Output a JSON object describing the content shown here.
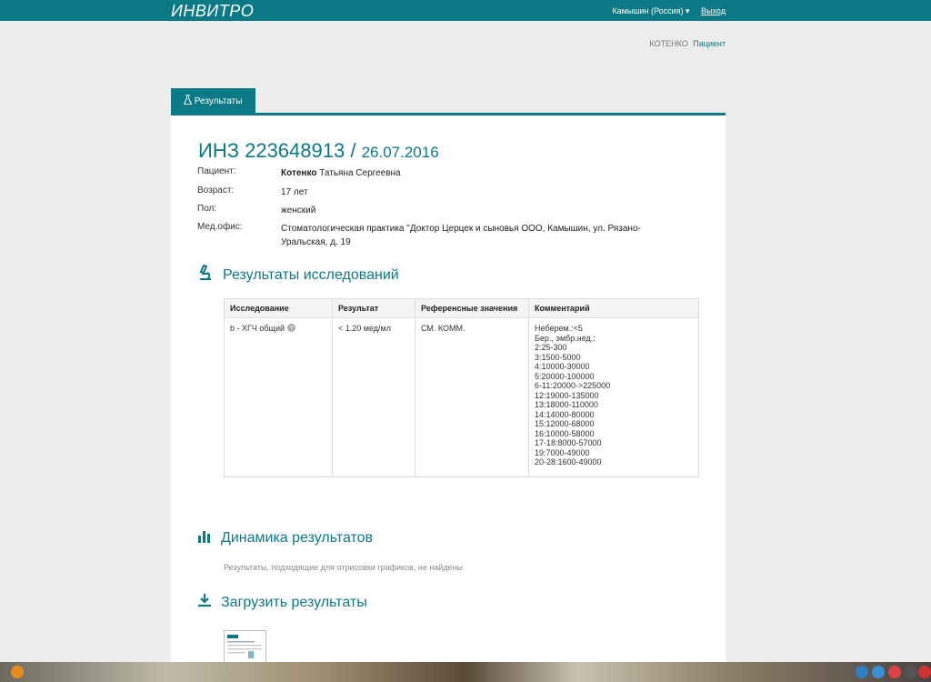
{
  "header": {
    "logo": "ИНВИТРО",
    "city": "Камышин (Россия) ▾",
    "logout": "Выход"
  },
  "user": {
    "name": "КОТЕНКО",
    "role": "Пациент"
  },
  "tab": {
    "label": "Результаты"
  },
  "order": {
    "number": "ИНЗ 223648913",
    "separator": " / ",
    "date": "26.07.2016"
  },
  "patient": {
    "patient_label": "Пациент:",
    "surname": "Котенко",
    "name": " Татьяна Сергеевна",
    "age_label": "Возраст:",
    "age": "17 лет",
    "sex_label": "Пол:",
    "sex": "женский",
    "office_label": "Мед.офис:",
    "office": "Стоматологическая практика \"Доктор Церцек и сыновья ООО, Камышин, ул. Рязано-Уральская, д. 19"
  },
  "results_section": {
    "title": "Результаты исследований",
    "columns": [
      "Исследование",
      "Результат",
      "Референсные значения",
      "Комментарий"
    ],
    "row": {
      "test": "b - ХГЧ общий",
      "result": "< 1.20 мед/мл",
      "reference": "СМ. КОММ.",
      "comment": [
        "Неберем.:<5",
        "Бер., эмбр.нед.:",
        "2:25-300",
        "3:1500-5000",
        "4:10000-30000",
        "5:20000-100000",
        "6-11:20000->225000",
        "12:19000-135000",
        "13:18000-110000",
        "14:14000-80000",
        "15:12000-68000",
        "16:10000-58000",
        "17-18:8000-57000",
        "19:7000-49000",
        "20-28:1600-49000"
      ]
    }
  },
  "dynamics_section": {
    "title": "Динамика результатов",
    "empty_text": "Результаты, подходящие для отрисовки графиков, не найдены"
  },
  "download_section": {
    "title": "Загрузить результаты"
  },
  "colors": {
    "brand": "#0b7a86"
  }
}
